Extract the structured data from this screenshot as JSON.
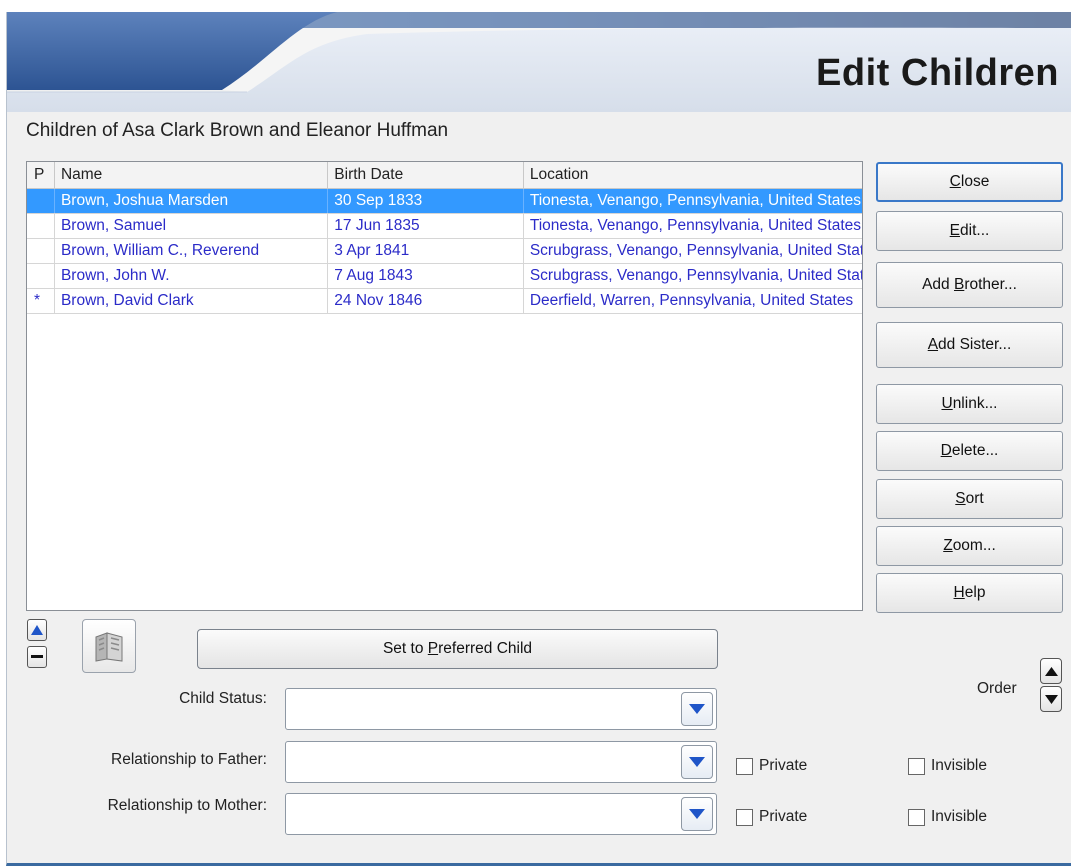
{
  "window": {
    "title": "Edit Children",
    "subtitle": "Children of Asa Clark Brown and Eleanor Huffman"
  },
  "grid": {
    "columns": [
      "P",
      "Name",
      "Birth Date",
      "Location"
    ],
    "rows": [
      {
        "p": "",
        "name": "Brown, Joshua Marsden",
        "birth": "30 Sep 1833",
        "location": "Tionesta, Venango, Pennsylvania, United States",
        "selected": true
      },
      {
        "p": "",
        "name": "Brown, Samuel",
        "birth": "17 Jun 1835",
        "location": "Tionesta, Venango, Pennsylvania, United States",
        "selected": false
      },
      {
        "p": "",
        "name": "Brown, William C., Reverend",
        "birth": "3 Apr 1841",
        "location": "Scrubgrass, Venango, Pennsylvania, United States",
        "selected": false
      },
      {
        "p": "",
        "name": "Brown, John W.",
        "birth": "7 Aug 1843",
        "location": "Scrubgrass, Venango, Pennsylvania, United States",
        "selected": false
      },
      {
        "p": "*",
        "name": "Brown, David Clark",
        "birth": "24 Nov 1846",
        "location": "Deerfield, Warren, Pennsylvania, United States",
        "selected": false
      }
    ]
  },
  "buttons": {
    "close": {
      "pre": "",
      "key": "C",
      "post": "lose"
    },
    "edit": {
      "pre": "",
      "key": "E",
      "post": "dit..."
    },
    "add_brother": {
      "pre": "Add ",
      "key": "B",
      "post": "rother..."
    },
    "add_sister": {
      "pre": "",
      "key": "A",
      "post": "dd Sister..."
    },
    "unlink": {
      "pre": "",
      "key": "U",
      "post": "nlink..."
    },
    "delete": {
      "pre": "",
      "key": "D",
      "post": "elete..."
    },
    "sort": {
      "pre": "",
      "key": "S",
      "post": "ort"
    },
    "zoom": {
      "pre": "",
      "key": "Z",
      "post": "oom..."
    },
    "help": {
      "pre": "",
      "key": "H",
      "post": "elp"
    },
    "preferred": {
      "pre": "Set to ",
      "key": "P",
      "post": "referred Child"
    }
  },
  "fields": {
    "child_status": {
      "label": "Child Status:",
      "value": ""
    },
    "rel_father": {
      "label": "Relationship to Father:",
      "value": ""
    },
    "rel_mother": {
      "label": "Relationship to Mother:",
      "value": ""
    }
  },
  "checkboxes": {
    "private_label": "Private",
    "invisible_label": "Invisible",
    "father_private": false,
    "father_invisible": false,
    "mother_private": false,
    "mother_invisible": false
  },
  "order": {
    "label": "Order"
  },
  "colors": {
    "accent": "#2b5aa0",
    "selected_row": "#3399ff",
    "row_text": "#2b2bc8"
  },
  "icons": {
    "up": "triangle-up-icon",
    "minus": "minus-icon",
    "book": "book-icon",
    "dropdown": "chevron-down-icon"
  }
}
